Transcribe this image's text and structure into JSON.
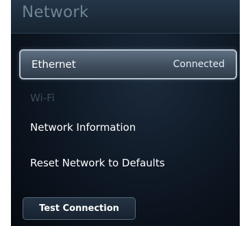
{
  "header": {
    "title": "Network"
  },
  "menu": {
    "items": [
      {
        "label": "Ethernet",
        "status": "Connected",
        "state": "selected"
      },
      {
        "label": "Wi-Fi",
        "state": "disabled"
      },
      {
        "label": "Network Information",
        "state": "normal"
      },
      {
        "label": "Reset Network to Defaults",
        "state": "normal"
      }
    ]
  },
  "actions": {
    "test_connection_label": "Test Connection"
  },
  "colors": {
    "background": "#0d1622",
    "header": "#1d2c3c",
    "title_text": "#6e8496",
    "selected_fill": "#4e5e70",
    "selected_border": "#b9c6d3",
    "disabled_text": "#3a4a5a"
  }
}
